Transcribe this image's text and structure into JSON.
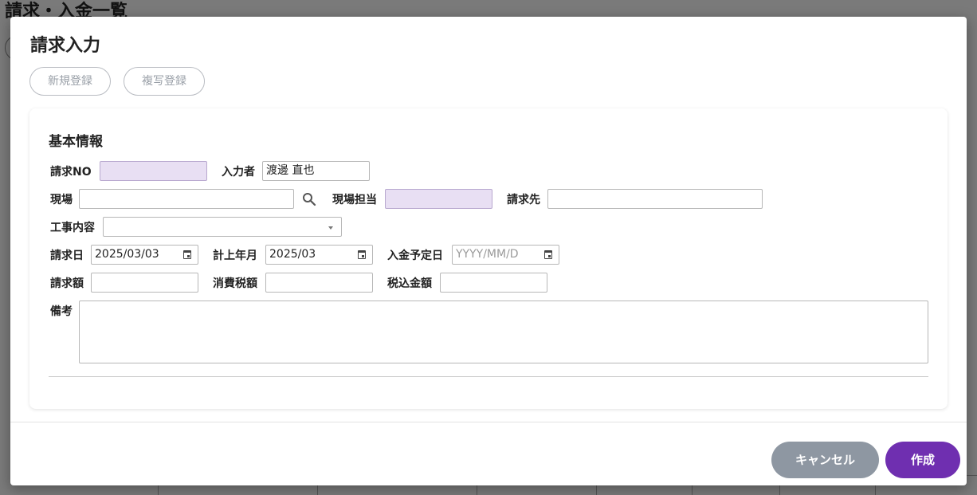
{
  "background": {
    "page_title": "請求・入金一覧"
  },
  "modal": {
    "title": "請求入力",
    "buttons": {
      "new_register": "新規登録",
      "copy_register": "複写登録"
    },
    "section_title": "基本情報",
    "fields": {
      "invoice_no": {
        "label": "請求NO",
        "value": ""
      },
      "entered_by": {
        "label": "入力者",
        "value": "渡邊 直也"
      },
      "site": {
        "label": "現場",
        "value": ""
      },
      "site_manager": {
        "label": "現場担当",
        "value": ""
      },
      "bill_to": {
        "label": "請求先",
        "value": ""
      },
      "work_content": {
        "label": "工事内容",
        "value": ""
      },
      "invoice_date": {
        "label": "請求日",
        "value": "2025/03/03"
      },
      "posting_month": {
        "label": "計上年月",
        "value": "2025/03"
      },
      "expected_payment_date": {
        "label": "入金予定日",
        "placeholder": "YYYY/MM/D"
      },
      "invoice_amount": {
        "label": "請求額",
        "value": ""
      },
      "consumption_tax": {
        "label": "消費税額",
        "value": ""
      },
      "total_incl_tax": {
        "label": "税込金額",
        "value": ""
      },
      "remarks": {
        "label": "備考",
        "value": ""
      }
    },
    "footer": {
      "cancel": "キャンセル",
      "create": "作成"
    }
  },
  "colors": {
    "readonly_field": "#e8dff3",
    "cancel_button": "#8e97a2",
    "create_button": "#6f2fb0"
  },
  "icons": [
    "search-icon",
    "calendar-icon",
    "dropdown-caret-icon"
  ]
}
